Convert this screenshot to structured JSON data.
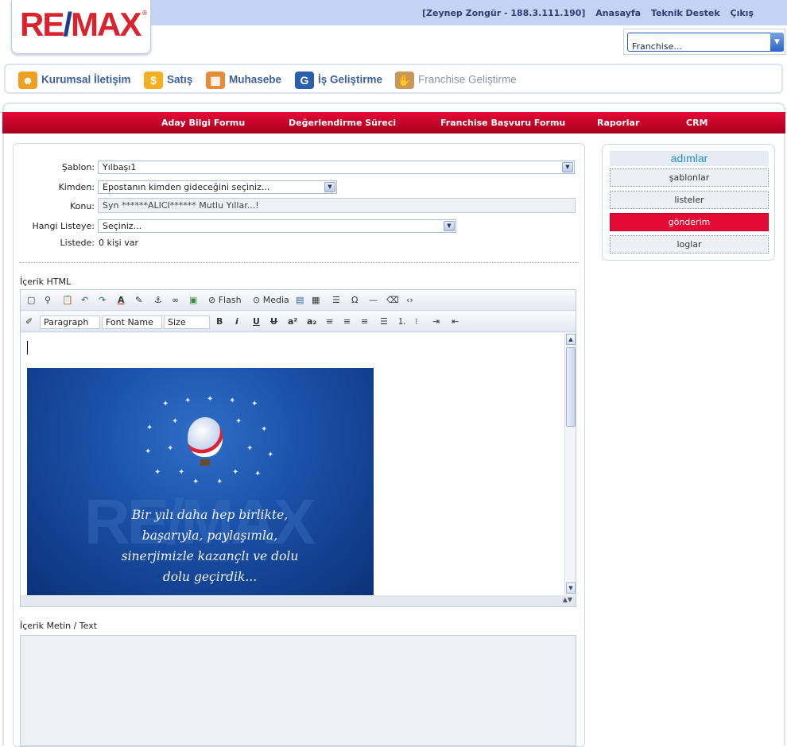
{
  "header": {
    "logo_text": "RE/MAX",
    "user_info": "[Zeynep Zongür - 188.3.111.190]",
    "links": [
      "Anasayfa",
      "Teknik Destek",
      "Çıkış"
    ],
    "franchise_select": "Franchise..."
  },
  "modules": [
    {
      "label": "Kurumsal İletişim",
      "icon": "people-icon"
    },
    {
      "label": "Satış",
      "icon": "sales-icon"
    },
    {
      "label": "Muhasebe",
      "icon": "accounting-icon"
    },
    {
      "label": "İş Geliştirme",
      "icon": "business-icon"
    },
    {
      "label": "Franchise Geliştirme",
      "icon": "handshake-icon"
    }
  ],
  "nav": [
    "Aday Bilgi Formu",
    "Değerlendirme Süreci",
    "Franchise Başvuru Formu",
    "Raporlar",
    "CRM"
  ],
  "form": {
    "sablon_label": "Şablon:",
    "sablon_value": "Yılbaşı1",
    "kimden_label": "Kimden:",
    "kimden_value": "Epostanın kimden gideceğini seçiniz...",
    "konu_label": "Konu:",
    "konu_value": "Syn ******ALICI****** Mutlu Yıllar...!",
    "liste_label": "Hangi Listeye:",
    "liste_value": "Seçiniz...",
    "listede_label": "Listede:",
    "listede_value": "0 kişi var"
  },
  "editor": {
    "html_label": "İçerik HTML",
    "flash_label": "Flash",
    "media_label": "Media",
    "paragraph": "Paragraph",
    "font_name": "Font Name",
    "size": "Size",
    "card_watermark": "RE/MAX",
    "card_poem": "Bir yılı daha hep birlikte, başarıyla, paylaşımla, sinerjimizle kazançlı ve dolu dolu geçirdik...",
    "text_label": "İçerik Metin / Text"
  },
  "sidebar": {
    "title": "adımlar",
    "steps": [
      "şablonlar",
      "listeler",
      "gönderim",
      "loglar"
    ],
    "active_step": "gönderim"
  },
  "colors": {
    "brand_red": "#e30a36",
    "brand_blue": "#1a3d8f",
    "nav_text": "#2f3f72"
  }
}
